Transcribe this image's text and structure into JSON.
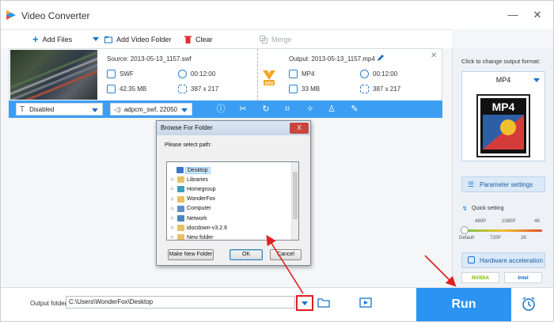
{
  "window": {
    "title": "Video Converter",
    "minimize": "—",
    "close": "✕"
  },
  "toolbar": {
    "add_files": "Add Files",
    "add_video_folder": "Add Video Folder",
    "clear": "Clear",
    "merge": "Merge"
  },
  "file": {
    "source": "Source: 2013-05-13_1157.swf",
    "output": "Output: 2013-05-13_1157.mp4",
    "src_format": "SWF",
    "src_duration": "00:12:00",
    "src_size": "42.35 MB",
    "src_resolution": "387 x 217",
    "out_format": "MP4",
    "out_duration": "00:12:00",
    "out_size": "33 MB",
    "out_resolution": "387 x 217",
    "gpu_label": "GPU"
  },
  "editbar": {
    "subtitle": "Disabled",
    "audio": "adpcm_swf, 22050"
  },
  "right_panel": {
    "change_format_text": "Click to change output format:",
    "format_name": "MP4",
    "format_icon_text": "MP4",
    "parameter_settings": "Parameter settings",
    "quick_setting": "Quick setting",
    "quality_top": [
      "480P",
      "1080P",
      "4K"
    ],
    "quality_bottom": [
      "Default",
      "720P",
      "2K"
    ],
    "hardware_acceleration": "Hardware acceleration",
    "nvidia": "NVIDIA",
    "intel": "Intel"
  },
  "bottom": {
    "output_folder_label": "Output folder:",
    "output_folder_value": "C:\\Users\\WonderFox\\Desktop",
    "run": "Run"
  },
  "dialog": {
    "title": "Browse For Folder",
    "close": "X",
    "prompt": "Please select path:",
    "tree": [
      {
        "label": "Desktop",
        "level": 0,
        "selected": true,
        "icon_color": "#3a78c6"
      },
      {
        "label": "Libraries",
        "level": 1,
        "icon_color": "#e8c060"
      },
      {
        "label": "Homegroup",
        "level": 1,
        "icon_color": "#3aa0c0"
      },
      {
        "label": "WonderFox",
        "level": 1,
        "icon_color": "#e8c060"
      },
      {
        "label": "Computer",
        "level": 1,
        "icon_color": "#5b8fc9"
      },
      {
        "label": "Network",
        "level": 1,
        "icon_color": "#4c86c0"
      },
      {
        "label": "idocdown-v3.2.6",
        "level": 1,
        "icon_color": "#e8c060"
      },
      {
        "label": "New folder",
        "level": 1,
        "icon_color": "#e8c060"
      }
    ],
    "make_new_folder": "Make New Folder",
    "ok": "OK",
    "cancel": "Cancel"
  },
  "colors": {
    "accent_blue": "#2b93f2",
    "editbar_blue": "#3b9ef3",
    "annotation_red": "#e02020"
  }
}
